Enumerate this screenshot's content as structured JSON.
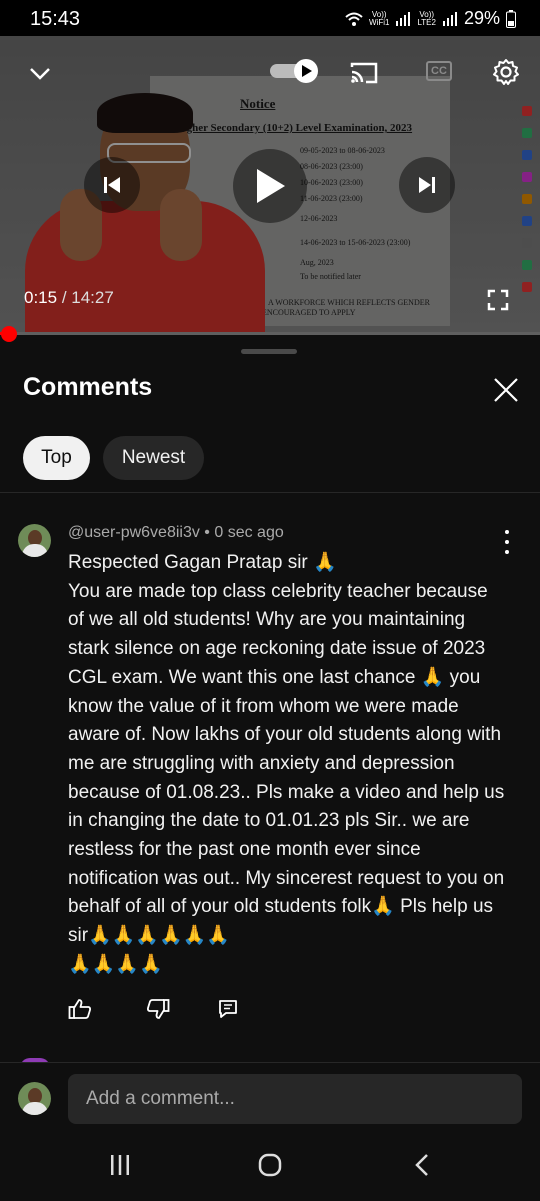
{
  "status_bar": {
    "time": "15:43",
    "wifi_label_top": "Vo))",
    "wifi_label_bottom": "WiFi1",
    "lte_label_top": "Vo))",
    "lte_label_bottom": "LTE2",
    "battery": "29%"
  },
  "video": {
    "current_time": "0:15",
    "separator": " / ",
    "duration": "14:27",
    "progress_fraction": 0.0173,
    "doc_title": "Notice",
    "doc_subtitle": "Higher Secondary (10+2) Level Examination, 2023",
    "doc_rows": [
      "09-05-2023 to 08-06-2023",
      "08-06-2023 (23:00)",
      "10-06-2023 (23:00)",
      "11-06-2023 (23:00)",
      "12-06-2023",
      "14-06-2023 to 15-06-2023 (23:00)",
      "Aug, 2023",
      "To be notified later"
    ],
    "doc_footer": "A WORKFORCE WHICH REFLECTS GENDER",
    "doc_footer2": "ENCOURAGED TO APPLY",
    "cc_label": "CC"
  },
  "comments_panel": {
    "title": "Comments",
    "chips": [
      {
        "label": "Top",
        "selected": true
      },
      {
        "label": "Newest",
        "selected": false
      }
    ]
  },
  "comment": {
    "author": "@user-pw6ve8ii3v",
    "dot": " • ",
    "time": "0 sec ago",
    "text": "Respected Gagan Pratap sir 🙏\nYou are made top class celebrity teacher because of we all old students! Why are you maintaining stark silence on age reckoning date issue of 2023 CGL exam. We want this one last chance 🙏 you know the value of it from whom we were made aware of. Now lakhs of your old students along with me are struggling with anxiety and depression because of 01.08.23.. Pls make a video and help us in changing the date to 01.01.23 pls Sir.. we are restless for the past one month ever since notification was out.. My sincerest request to you on behalf of all of your old students folk🙏 Pls help us sir🙏🙏🙏🙏🙏🙏\n🙏🙏🙏🙏"
  },
  "composer": {
    "placeholder": "Add a comment..."
  },
  "colors": {
    "background": "#0f0f0f",
    "chip_selected": "#f1f1f1",
    "chip_unselected": "#272727",
    "progress": "#ff0000",
    "secondary_text": "#aaaaaa"
  },
  "icons": [
    "chevron-down-icon",
    "autoplay-toggle-icon",
    "cast-icon",
    "captions-icon",
    "settings-gear-icon",
    "previous-icon",
    "play-icon",
    "next-icon",
    "fullscreen-icon",
    "close-icon",
    "more-vert-icon",
    "like-icon",
    "dislike-icon",
    "reply-icon",
    "recents-nav-icon",
    "home-nav-icon",
    "back-nav-icon"
  ]
}
